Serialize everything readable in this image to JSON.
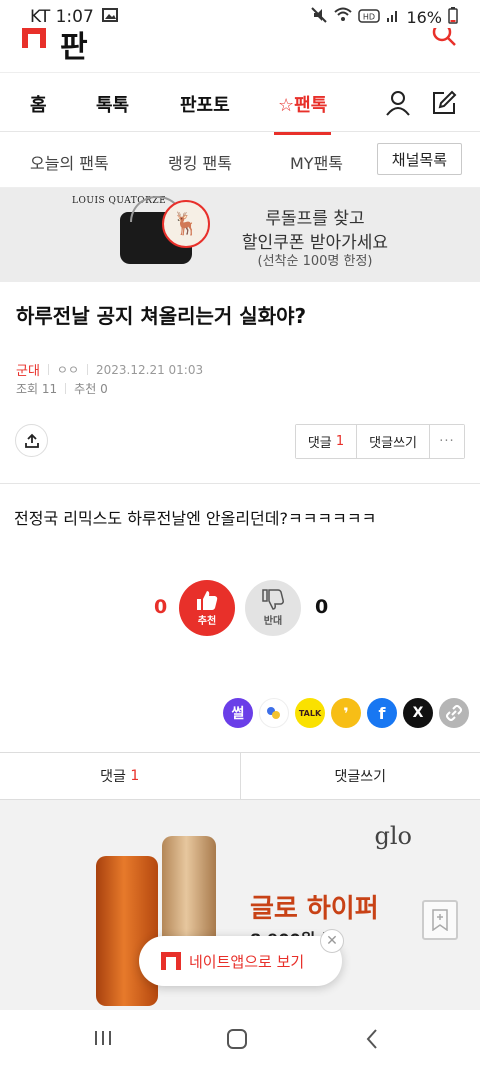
{
  "status_bar": {
    "carrier_time": "KT 1:07",
    "battery": "16%"
  },
  "header": {
    "logo_text": "판"
  },
  "main_nav": {
    "items": [
      "홈",
      "톡톡",
      "판포토",
      "☆팬톡"
    ]
  },
  "sub_nav": {
    "items": [
      "오늘의 팬톡",
      "랭킹 팬톡",
      "MY팬톡"
    ],
    "channel_button": "채널목록"
  },
  "ad_banner": {
    "brand": "LOUIS QUATORZE",
    "line1": "루돌프를 찾고",
    "line2": "할인쿠폰 받아가세요",
    "line3": "(선착순 100명 한정)"
  },
  "post": {
    "title": "하루전날 공지 쳐올리는거 실화야?",
    "channel": "군대",
    "author": "ㅇㅇ",
    "date": "2023.12.21 01:03",
    "views": "조회 11",
    "recommends": "추천 0",
    "body": "전정국 리믹스도 하루전날엔 안올리던데?ㅋㅋㅋㅋㅋㅋ"
  },
  "actions": {
    "comment_label": "댓글",
    "comment_count": "1",
    "write_label": "댓글쓰기",
    "more": "···"
  },
  "vote": {
    "up_count": "0",
    "up_label": "추천",
    "down_label": "반대",
    "down_count": "0"
  },
  "share": {
    "icons": [
      "ssul-icon",
      "band-icon",
      "kakaotalk-icon",
      "kakaostory-icon",
      "facebook-icon",
      "x-icon",
      "link-icon"
    ],
    "ssul_text": "썰",
    "talk_text": "TALK",
    "x_text": "X",
    "fb_text": "f"
  },
  "comment_bar": {
    "comment_label": "댓글",
    "comment_count": "1",
    "write_label": "댓글쓰기"
  },
  "glo_ad": {
    "logo": "glo",
    "title": "글로 하이퍼",
    "price_partial": "8,900원 부"
  },
  "app_popup": {
    "text": "네이트앱으로 보기"
  },
  "colors": {
    "accent": "#e8302a",
    "vote_down_bg": "#e3e3e3"
  }
}
